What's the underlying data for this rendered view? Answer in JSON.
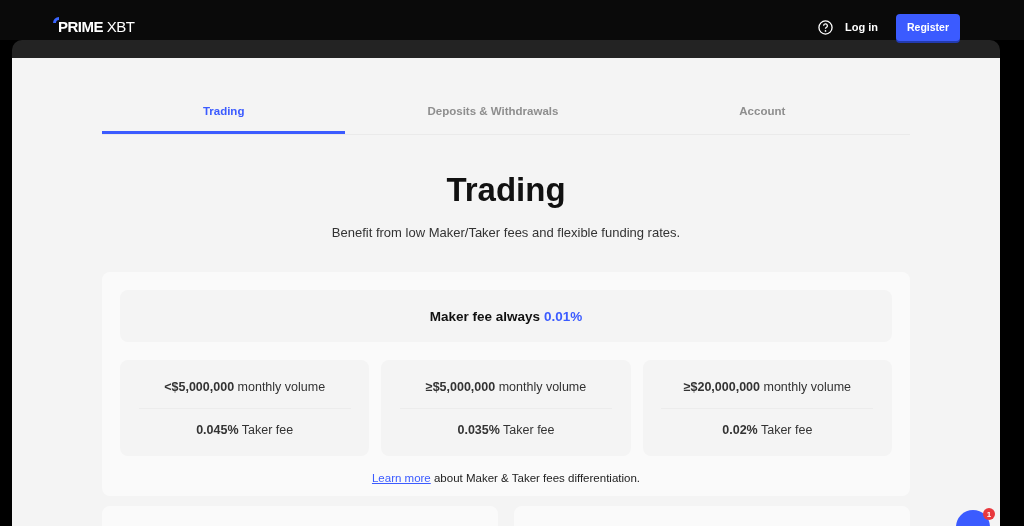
{
  "header": {
    "logo": "**PRIME** XBT",
    "login": "Log in",
    "register": "Register"
  },
  "tabs": [
    {
      "label": "Trading",
      "selected": true
    },
    {
      "label": "Deposits & Withdrawals",
      "selected": false
    },
    {
      "label": "Account",
      "selected": false
    }
  ],
  "heading": "Trading",
  "subtitle": "Benefit from low Maker/Taker fees and flexible funding rates.",
  "maker": {
    "label": "Maker fee always",
    "value": "0.01%"
  },
  "tiers": [
    {
      "volume": "**<$5,000,000** monthly volume",
      "fee": "**0.045%** Taker fee"
    },
    {
      "volume": "**≥$5,000,000** monthly volume",
      "fee": "**0.035%** Taker fee"
    },
    {
      "volume": "**≥$20,000,000** monthly volume",
      "fee": "**0.02%** Taker fee"
    }
  ],
  "learn": {
    "link": "Learn more",
    "rest": "about Maker & Taker fees differentiation."
  },
  "chat": {
    "badge": "1"
  }
}
